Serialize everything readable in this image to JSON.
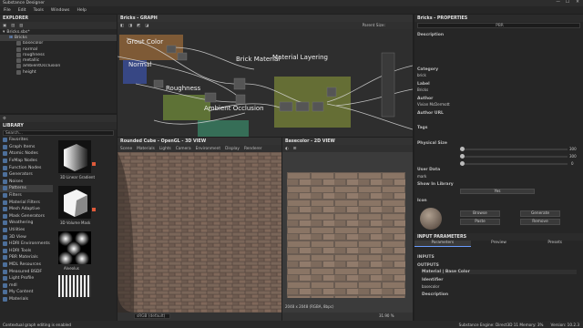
{
  "titlebar": {
    "title": "Substance Designer"
  },
  "menu": [
    "File",
    "Edit",
    "Tools",
    "Windows",
    "Help"
  ],
  "explorer": {
    "title": "EXPLORER",
    "package": "Bricks.sbs*",
    "graph": "Bricks",
    "outputs": [
      "basecolor",
      "normal",
      "roughness",
      "metallic",
      "ambientOcclusion",
      "height"
    ]
  },
  "library": {
    "title": "LIBRARY",
    "search_placeholder": "Search...",
    "tree": [
      "Favorites",
      "Graph Items",
      "Atomic Nodes",
      "FxMap Nodes",
      "Function Nodes",
      "Generators",
      "Noises",
      "Patterns",
      "Filters",
      "Material Filters",
      "Mesh Adaptive",
      "Mask Generators",
      "Weathering",
      "Utilities",
      "3D View",
      "HDRI Environments",
      "HDRI Tools",
      "PBR Materials",
      "MDL Resources",
      "Measured BSDF",
      "Light Profile",
      "mdl",
      "My Content",
      "Materials"
    ],
    "selected": "Patterns",
    "thumbs": [
      "3D Linear Gradient",
      "3D Volume Mask",
      "Alveolus"
    ]
  },
  "graph": {
    "tab": "Bricks - GRAPH",
    "parent_size_label": "Parent Size:",
    "frames": [
      "Grout Color",
      "Normal",
      "Roughness",
      "Brick Material",
      "Material Layering",
      "Ambient Occlusion"
    ]
  },
  "view3d": {
    "tab": "Rounded Cube - OpenGL - 3D VIEW",
    "menu": [
      "Scene",
      "Materials",
      "Lights",
      "Camera",
      "Environment",
      "Display",
      "Renderer"
    ],
    "colorspace": "sRGB (default)"
  },
  "view2d": {
    "tab": "Basecolor - 2D VIEW",
    "info": "2048 x 2048 (RGBA, 8bpc)",
    "zoom": "31.90 %"
  },
  "properties": {
    "title": "Bricks - PROPERTIES",
    "top_field": "PBR",
    "sections": {
      "description": "Description",
      "category": "Category",
      "category_value": "brick",
      "label": "Label",
      "label_value": "Bricks",
      "author": "Author",
      "author_value": "Vivian McDermott",
      "author_url": "Author URL",
      "tags": "Tags",
      "physical_size": "Physical Size",
      "size_values": [
        "300",
        "300",
        "0"
      ],
      "user_data": "User Data",
      "user_value": "mark",
      "show_in_library": "Show In Library",
      "show_value": "Yes",
      "icon": "Icon"
    },
    "icon_buttons": [
      "Browse",
      "Generate",
      "Paste",
      "Remove"
    ],
    "input_params": "INPUT PARAMETERS",
    "tabs": [
      "Parameters",
      "Preview",
      "Presets"
    ],
    "inputs": "INPUTS",
    "outputs": "OUTPUTS",
    "output_item": "Material | Base Color",
    "identifier": "Identifier",
    "identifier_value": "basecolor",
    "desc2": "Description"
  },
  "status": {
    "left": "Contextual graph editing is enabled",
    "right": "Substance Engine: Direct3D 11  Memory: 3%",
    "version": "Version: 10.2.3"
  }
}
